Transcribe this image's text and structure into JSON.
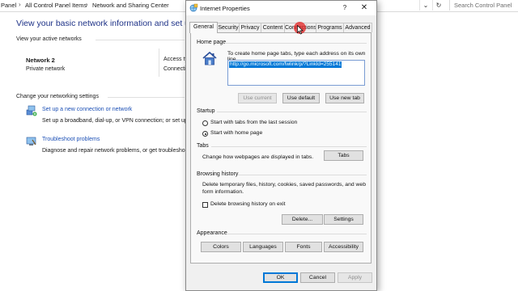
{
  "background": {
    "address_bar": {
      "crumbs": [
        "Panel",
        "All Control Panel Items",
        "Network and Sharing Center"
      ],
      "search_placeholder": "Search Control Panel"
    },
    "heading": "View your basic network information and set up con",
    "active_networks_label": "View your active networks",
    "network": {
      "name": "Network 2",
      "type": "Private network"
    },
    "access_label": "Access ty",
    "connections_label": "Connecti",
    "change_settings_label": "Change your networking settings",
    "tasks": [
      {
        "link": "Set up a new connection or network",
        "desc": "Set up a broadband, dial-up, or VPN connection; or set up"
      },
      {
        "link": "Troubleshoot problems",
        "desc": "Diagnose and repair network problems, or get troubleshoo"
      }
    ]
  },
  "dialog": {
    "title": "Internet Properties",
    "help_glyph": "?",
    "close_glyph": "✕",
    "tabs": [
      "General",
      "Security",
      "Privacy",
      "Content",
      "Connections",
      "Programs",
      "Advanced"
    ],
    "active_tab": "General",
    "home_page": {
      "label": "Home page",
      "instruction": "To create home page tabs, type each address on its own line.",
      "url": "http://go.microsoft.com/fwlink/p/?LinkId=255141",
      "buttons": {
        "use_current": "Use current",
        "use_default": "Use default",
        "use_new_tab": "Use new tab"
      }
    },
    "startup": {
      "label": "Startup",
      "options": [
        "Start with tabs from the last session",
        "Start with home page"
      ],
      "selected_index": 1
    },
    "tabs_section": {
      "label": "Tabs",
      "desc": "Change how webpages are displayed in tabs.",
      "button": "Tabs"
    },
    "browsing_history": {
      "label": "Browsing history",
      "desc_line1": "Delete temporary files, history, cookies, saved passwords, and web",
      "desc_line2": "form information.",
      "checkbox_label": "Delete browsing history on exit",
      "checkbox_checked": false,
      "buttons": {
        "delete": "Delete...",
        "settings": "Settings"
      }
    },
    "appearance": {
      "label": "Appearance",
      "buttons": {
        "colors": "Colors",
        "languages": "Languages",
        "fonts": "Fonts",
        "accessibility": "Accessibility"
      }
    },
    "footer": {
      "ok": "OK",
      "cancel": "Cancel",
      "apply": "Apply"
    }
  },
  "colors": {
    "accent": "#0078d7",
    "heading_blue": "#1e3287",
    "link_blue": "#1b4fb5",
    "cursor_highlight": "#e22828"
  }
}
